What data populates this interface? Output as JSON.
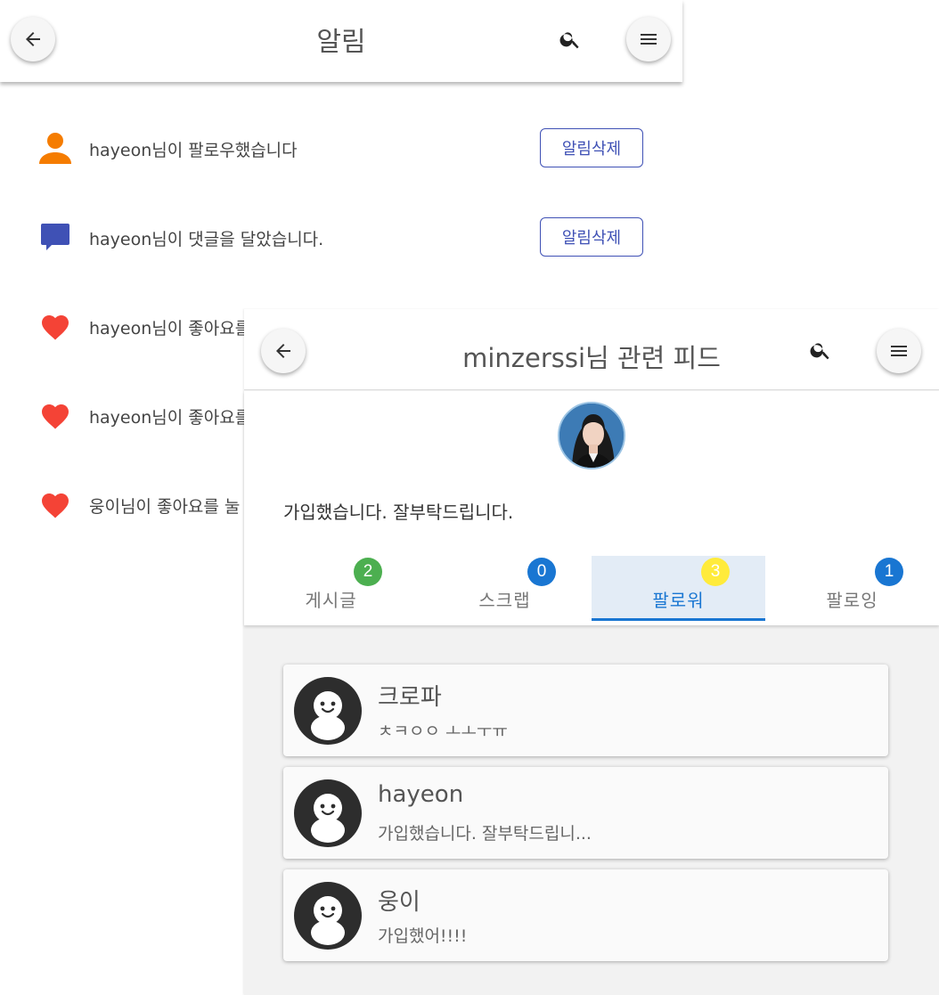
{
  "notifications_screen": {
    "title": "알림",
    "icons": {
      "back": "arrow-left-icon",
      "search": "search-icon",
      "menu": "hamburger-menu-icon"
    },
    "items": [
      {
        "icon": "person-icon",
        "icon_color": "#f57c00",
        "text": "hayeon님이 팔로우했습니다",
        "button": "알림삭제"
      },
      {
        "icon": "comment-icon",
        "icon_color": "#3f51b5",
        "text": "hayeon님이 댓글을 달았습니다.",
        "button": "알림삭제"
      },
      {
        "icon": "heart-icon",
        "icon_color": "#f44336",
        "text": "hayeon님이 좋아요를"
      },
      {
        "icon": "heart-icon",
        "icon_color": "#f44336",
        "text": "hayeon님이 좋아요를"
      },
      {
        "icon": "heart-icon",
        "icon_color": "#f44336",
        "text": "웅이님이 좋아요를 눌"
      }
    ]
  },
  "feed_screen": {
    "title": "minzerssi님 관련 피드",
    "bio": "가입했습니다. 잘부탁드립니다.",
    "tabs": [
      {
        "label": "게시글",
        "count": "2",
        "badge_color": "#4caf50",
        "active": false
      },
      {
        "label": "스크랩",
        "count": "0",
        "badge_color": "#1976d2",
        "active": false
      },
      {
        "label": "팔로워",
        "count": "3",
        "badge_color": "#ffeb3b",
        "active": true
      },
      {
        "label": "팔로잉",
        "count": "1",
        "badge_color": "#1976d2",
        "active": false
      }
    ],
    "followers": [
      {
        "name": "크로파",
        "bio": "ㅊㅋㅇㅇ ㅗㅗㅜㅠ"
      },
      {
        "name": "hayeon",
        "bio": "가입했습니다. 잘부탁드립니..."
      },
      {
        "name": "웅이",
        "bio": "가입했어!!!!"
      }
    ]
  },
  "colors": {
    "accent": "#1976d2",
    "primary_indigo": "#3f51b5"
  }
}
